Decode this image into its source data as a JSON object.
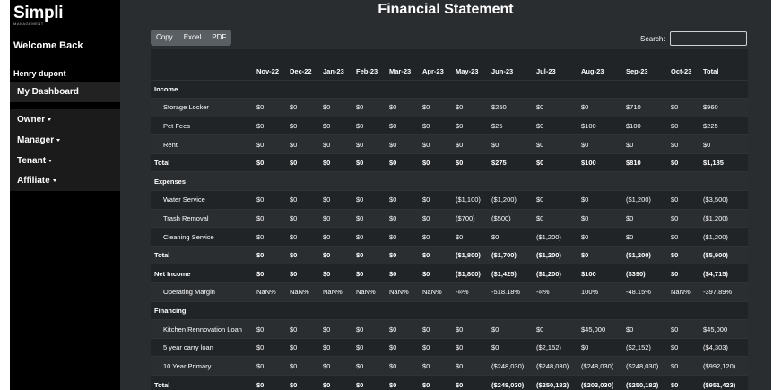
{
  "sidebar": {
    "logo": "Simpli",
    "logo_sub": "MANAGEMENT",
    "welcome": "Welcome Back",
    "user": "Henry dupont",
    "dashboard": "My Dashboard",
    "menu": [
      {
        "label": "Owner"
      },
      {
        "label": "Manager"
      },
      {
        "label": "Tenant"
      },
      {
        "label": "Affiliate"
      }
    ]
  },
  "main": {
    "title": "Financial Statement",
    "buttons": {
      "copy": "Copy",
      "excel": "Excel",
      "pdf": "PDF"
    },
    "search_label": "Search:",
    "search_value": ""
  },
  "table": {
    "headers": [
      "",
      "Nov-22",
      "Dec-22",
      "Jan-23",
      "Feb-23",
      "Mar-23",
      "Apr-23",
      "May-23",
      "Jun-23",
      "Jul-23",
      "Aug-23",
      "Sep-23",
      "Oct-23",
      "Total"
    ],
    "rows": [
      {
        "type": "section",
        "cells": [
          "Income",
          "",
          "",
          "",
          "",
          "",
          "",
          "",
          "",
          "",
          "",
          "",
          "",
          ""
        ]
      },
      {
        "type": "item",
        "cells": [
          "Storage Locker",
          "$0",
          "$0",
          "$0",
          "$0",
          "$0",
          "$0",
          "$0",
          "$250",
          "$0",
          "$0",
          "$710",
          "$0",
          "$960"
        ]
      },
      {
        "type": "item",
        "cells": [
          "Pet Fees",
          "$0",
          "$0",
          "$0",
          "$0",
          "$0",
          "$0",
          "$0",
          "$25",
          "$0",
          "$100",
          "$100",
          "$0",
          "$225"
        ]
      },
      {
        "type": "item",
        "cells": [
          "Rent",
          "$0",
          "$0",
          "$0",
          "$0",
          "$0",
          "$0",
          "$0",
          "$0",
          "$0",
          "$0",
          "$0",
          "$0",
          "$0"
        ]
      },
      {
        "type": "total",
        "cells": [
          "Total",
          "$0",
          "$0",
          "$0",
          "$0",
          "$0",
          "$0",
          "$0",
          "$275",
          "$0",
          "$100",
          "$810",
          "$0",
          "$1,185"
        ]
      },
      {
        "type": "section",
        "cells": [
          "Expenses",
          "",
          "",
          "",
          "",
          "",
          "",
          "",
          "",
          "",
          "",
          "",
          "",
          ""
        ]
      },
      {
        "type": "item",
        "cells": [
          "Water Service",
          "$0",
          "$0",
          "$0",
          "$0",
          "$0",
          "$0",
          "($1,100)",
          "($1,200)",
          "$0",
          "$0",
          "($1,200)",
          "$0",
          "($3,500)"
        ]
      },
      {
        "type": "item",
        "cells": [
          "Trash Removal",
          "$0",
          "$0",
          "$0",
          "$0",
          "$0",
          "$0",
          "($700)",
          "($500)",
          "$0",
          "$0",
          "$0",
          "$0",
          "($1,200)"
        ]
      },
      {
        "type": "item",
        "cells": [
          "Cleaning Service",
          "$0",
          "$0",
          "$0",
          "$0",
          "$0",
          "$0",
          "$0",
          "$0",
          "($1,200)",
          "$0",
          "$0",
          "$0",
          "($1,200)"
        ]
      },
      {
        "type": "total",
        "cells": [
          "Total",
          "$0",
          "$0",
          "$0",
          "$0",
          "$0",
          "$0",
          "($1,800)",
          "($1,700)",
          "($1,200)",
          "$0",
          "($1,200)",
          "$0",
          "($5,900)"
        ]
      },
      {
        "type": "total",
        "cells": [
          "Net Income",
          "$0",
          "$0",
          "$0",
          "$0",
          "$0",
          "$0",
          "($1,800)",
          "($1,425)",
          "($1,200)",
          "$100",
          "($390)",
          "$0",
          "($4,715)"
        ]
      },
      {
        "type": "item",
        "cells": [
          "Operating Margin",
          "NaN%",
          "NaN%",
          "NaN%",
          "NaN%",
          "NaN%",
          "NaN%",
          "-∞%",
          "-518.18%",
          "-∞%",
          "100%",
          "-48.15%",
          "NaN%",
          "-397.89%"
        ]
      },
      {
        "type": "section",
        "cells": [
          "Financing",
          "",
          "",
          "",
          "",
          "",
          "",
          "",
          "",
          "",
          "",
          "",
          "",
          ""
        ]
      },
      {
        "type": "item",
        "cells": [
          "Kitchen Rennovation Loan",
          "$0",
          "$0",
          "$0",
          "$0",
          "$0",
          "$0",
          "$0",
          "$0",
          "$0",
          "$45,000",
          "$0",
          "$0",
          "$45,000"
        ]
      },
      {
        "type": "item",
        "cells": [
          "5 year carry loan",
          "$0",
          "$0",
          "$0",
          "$0",
          "$0",
          "$0",
          "$0",
          "$0",
          "($2,152)",
          "$0",
          "($2,152)",
          "$0",
          "($4,303)"
        ]
      },
      {
        "type": "item",
        "cells": [
          "10 Year Primary",
          "$0",
          "$0",
          "$0",
          "$0",
          "$0",
          "$0",
          "$0",
          "($248,030)",
          "($248,030)",
          "($248,030)",
          "($248,030)",
          "$0",
          "($992,120)"
        ]
      },
      {
        "type": "total",
        "cells": [
          "Total",
          "$0",
          "$0",
          "$0",
          "$0",
          "$0",
          "$0",
          "$0",
          "($248,030)",
          "($250,182)",
          "($203,030)",
          "($250,182)",
          "$0",
          "($951,423)"
        ]
      }
    ]
  }
}
